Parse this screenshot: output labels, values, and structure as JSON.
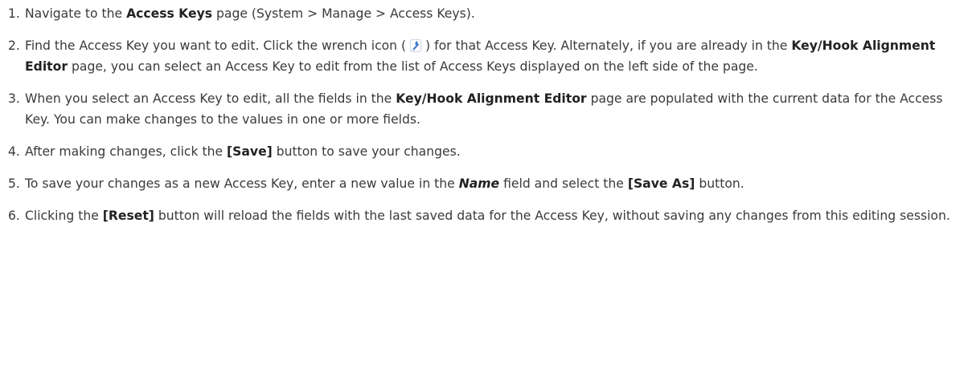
{
  "steps": [
    {
      "number": "1.",
      "parts": [
        {
          "text": "Navigate to the ",
          "style": "normal"
        },
        {
          "text": "Access Keys",
          "style": "bold"
        },
        {
          "text": " page (System > Manage > Access Keys).",
          "style": "normal"
        }
      ]
    },
    {
      "number": "2.",
      "parts": [
        {
          "text": "Find the Access Key you want to edit. Click the wrench icon (",
          "style": "normal"
        },
        {
          "icon": "wrench-icon"
        },
        {
          "text": ") for that Access Key. Alternately, if you are already in the ",
          "style": "normal"
        },
        {
          "text": "Key/Hook Alignment Editor",
          "style": "bold"
        },
        {
          "text": " page, you can select an Access Key to edit from the list of Access Keys displayed on the left side of the page.",
          "style": "normal"
        }
      ]
    },
    {
      "number": "3.",
      "parts": [
        {
          "text": "When you select an Access Key to edit, all the fields in the ",
          "style": "normal"
        },
        {
          "text": "Key/Hook Alignment Editor",
          "style": "bold"
        },
        {
          "text": " page are populated with the current data for the Access Key. You can make changes to the values in one or more fields.",
          "style": "normal"
        }
      ]
    },
    {
      "number": "4.",
      "parts": [
        {
          "text": "After making changes, click the ",
          "style": "normal"
        },
        {
          "text": "[Save]",
          "style": "bold"
        },
        {
          "text": " button to save your changes.",
          "style": "normal"
        }
      ]
    },
    {
      "number": "5.",
      "parts": [
        {
          "text": "To save your changes as a new Access Key, enter a new value in the ",
          "style": "normal"
        },
        {
          "text": "Name",
          "style": "bolditalic"
        },
        {
          "text": " field and select the ",
          "style": "normal"
        },
        {
          "text": "[Save As]",
          "style": "bold"
        },
        {
          "text": " button.",
          "style": "normal"
        }
      ]
    },
    {
      "number": "6.",
      "parts": [
        {
          "text": "Clicking the ",
          "style": "normal"
        },
        {
          "text": "[Reset]",
          "style": "bold"
        },
        {
          "text": " button will reload the fields with the last saved data for the Access Key, without saving any changes from this editing session.",
          "style": "normal"
        }
      ]
    }
  ],
  "colors": {
    "text": "#3a3a3a",
    "emphasis": "#222222",
    "wrench_blue": "#3c78c8"
  }
}
